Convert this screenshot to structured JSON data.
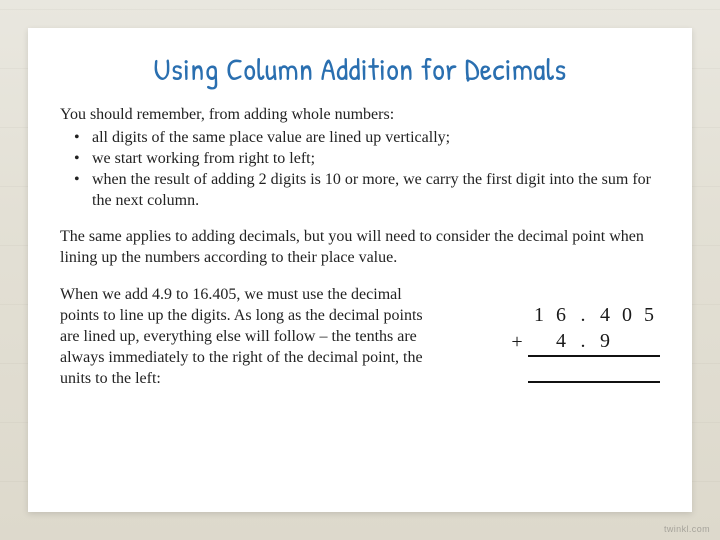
{
  "title": "Using Column Addition for Decimals",
  "intro": "You should remember, from adding whole numbers:",
  "bullets": [
    "all digits of the same place value are lined up vertically;",
    "we start working from right to left;",
    "when the result of adding 2 digits is 10 or more, we carry the first digit into the sum for the next column."
  ],
  "para1": "The same applies to adding decimals, but you will need to consider the decimal point when lining up the numbers according to their place value.",
  "para2": "When we add 4.9 to 16.405, we must use the decimal points to line up the digits. As long as the decimal points are lined up, everything else will follow – the tenths are always immediately to the right of the decimal point, the units to the left:",
  "math": {
    "row1": {
      "op": "",
      "c1": "1",
      "c2": "6",
      "dot": ".",
      "c3": "4",
      "c4": "0",
      "c5": "5"
    },
    "row2": {
      "op": "+",
      "c1": "",
      "c2": "4",
      "dot": ".",
      "c3": "9",
      "c4": "",
      "c5": ""
    }
  },
  "watermark": "twinkl.com"
}
